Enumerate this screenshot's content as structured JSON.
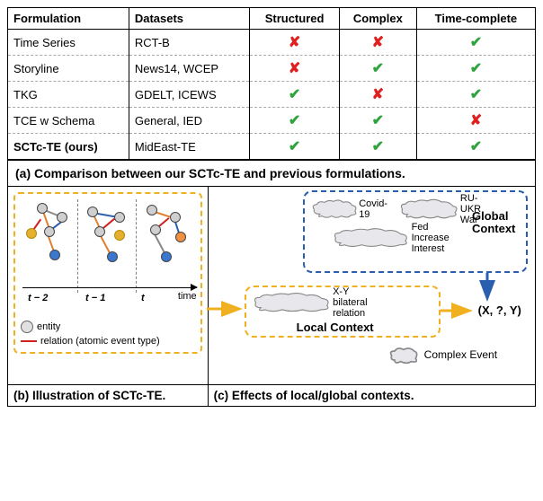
{
  "table": {
    "headers": [
      "Formulation",
      "Datasets",
      "Structured",
      "Complex",
      "Time-complete"
    ],
    "rows": [
      {
        "formulation": "Time Series",
        "datasets": "RCT-B",
        "structured": "no",
        "complex": "no",
        "timecomplete": "yes"
      },
      {
        "formulation": "Storyline",
        "datasets": "News14, WCEP",
        "structured": "no",
        "complex": "yes",
        "timecomplete": "yes"
      },
      {
        "formulation": "TKG",
        "datasets": "GDELT, ICEWS",
        "structured": "yes",
        "complex": "no",
        "timecomplete": "yes"
      },
      {
        "formulation": "TCE w Schema",
        "datasets": "General, IED",
        "structured": "yes",
        "complex": "yes",
        "timecomplete": "no"
      },
      {
        "formulation": "SCTc-TE (ours)",
        "datasets": "MidEast-TE",
        "structured": "yes",
        "complex": "yes",
        "timecomplete": "yes"
      }
    ]
  },
  "captions": {
    "a": "(a) Comparison between our SCTc-TE and previous formulations.",
    "b": "(b) Illustration of SCTc-TE.",
    "c": "(c) Effects of local/global contexts."
  },
  "panelB": {
    "time_labels": [
      "t − 2",
      "t − 1",
      "t"
    ],
    "axis_label": "time",
    "legend_entity": "entity",
    "legend_relation": "relation (atomic event type)"
  },
  "panelC": {
    "global_label": "Global\nContext",
    "local_label": "Local Context",
    "complex_event_label": "Complex Event",
    "output": "(X, ?, Y)",
    "clouds": {
      "covid": "Covid-19",
      "war": "RU-UKR War",
      "fed": "Fed Increase Interest",
      "bilateral": "X-Y bilateral relation"
    }
  },
  "symbols": {
    "yes": "✔",
    "no": "✘"
  }
}
